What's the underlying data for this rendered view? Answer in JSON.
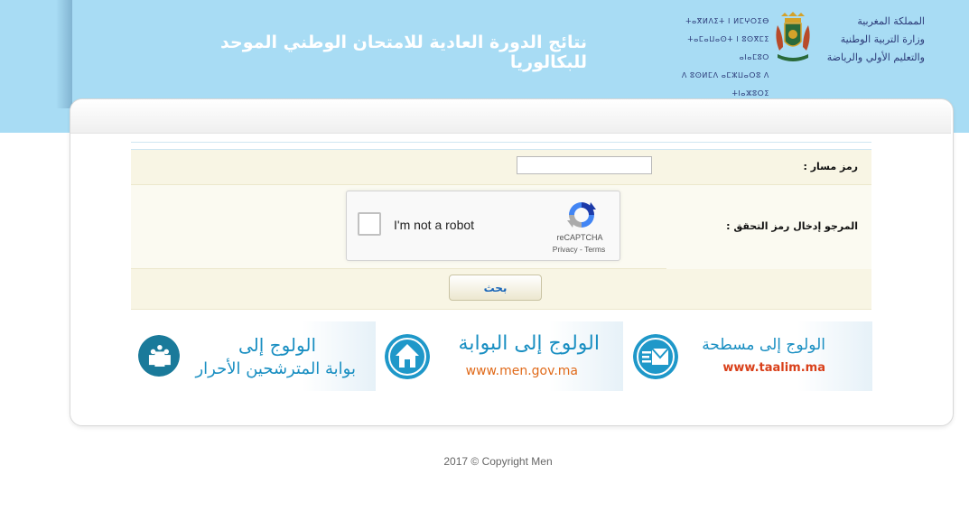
{
  "header": {
    "title": "نتائج الدورة العادية للامتحان الوطني الموحد للبكالوريا",
    "ministry_ar": [
      "المملكة المغربية",
      "وزارة التربية الوطنية",
      "والتعليم الأولي والرياضة"
    ],
    "ministry_tz": [
      "ⵜⴰⴳⵍⴷⵉⵜ ⵏ ⵍⵎⵖⵔⵉⴱ",
      "ⵜⴰⵎⴰⵡⴰⵙⵜ ⵏ ⵓⵙⴳⵎⵉ ⴰⵏⴰⵎⵓⵔ",
      "ⴷ ⵓⵙⵍⵎⴷ ⴰⵎⵣⵡⴰⵔⵓ ⴷ ⵜⵏⴰⵣⵓⵔⵉ"
    ]
  },
  "form": {
    "massar_label": "رمز مسار :",
    "massar_value": "",
    "captcha_label": "المرجو إدخال رمز التحقق :",
    "recaptcha": {
      "checkbox_text": "I'm not a robot",
      "brand": "reCAPTCHA",
      "links": "Privacy - Terms"
    },
    "search_label": "بحث"
  },
  "links": [
    {
      "title": "الولوج إلى مسطحة",
      "subtitle": "www.taalim.ma",
      "icon": "mail-lines-icon",
      "subtitle_color": "#d9401a"
    },
    {
      "title": "الولوج إلى البوابة",
      "subtitle": "www.men.gov.ma",
      "icon": "home-icon",
      "subtitle_color": "#e06a1a"
    },
    {
      "title": "الولوج إلى",
      "subtitle": "بوابة المترشحين الأحرار",
      "icon": "people-icon",
      "subtitle_color": "#1a8fc2"
    }
  ],
  "footer": {
    "copyright": "2017 © Copyright Men"
  },
  "colors": {
    "banner": "#a8dcf4",
    "link_blue": "#1a8fc2",
    "icon_circle": "#1f98c9"
  }
}
